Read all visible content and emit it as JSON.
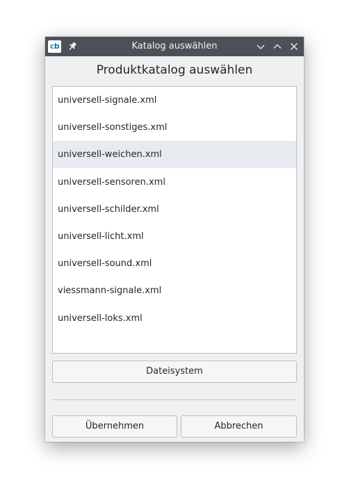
{
  "window": {
    "title": "Katalog auswählen",
    "app_icon_text_a": "c",
    "app_icon_text_b": "b"
  },
  "dialog": {
    "heading": "Produktkatalog auswählen",
    "catalog_items": [
      "universell-signale.xml",
      "universell-sonstiges.xml",
      "universell-weichen.xml",
      "universell-sensoren.xml",
      "universell-schilder.xml",
      "universell-licht.xml",
      "universell-sound.xml",
      "viessmann-signale.xml",
      "universell-loks.xml"
    ],
    "selected_index": 2,
    "filesystem_button": "Dateisystem",
    "accept_button": "Übernehmen",
    "cancel_button": "Abbrechen"
  },
  "icons": {
    "app": "cb-app-icon",
    "pin": "pin-icon",
    "minimize": "chevron-down-icon",
    "maximize": "chevron-up-icon",
    "close": "close-icon"
  },
  "colors": {
    "titlebar": "#4d5057",
    "window_bg": "#eff0f1",
    "selection": "#e8ebef",
    "text": "#232629"
  }
}
